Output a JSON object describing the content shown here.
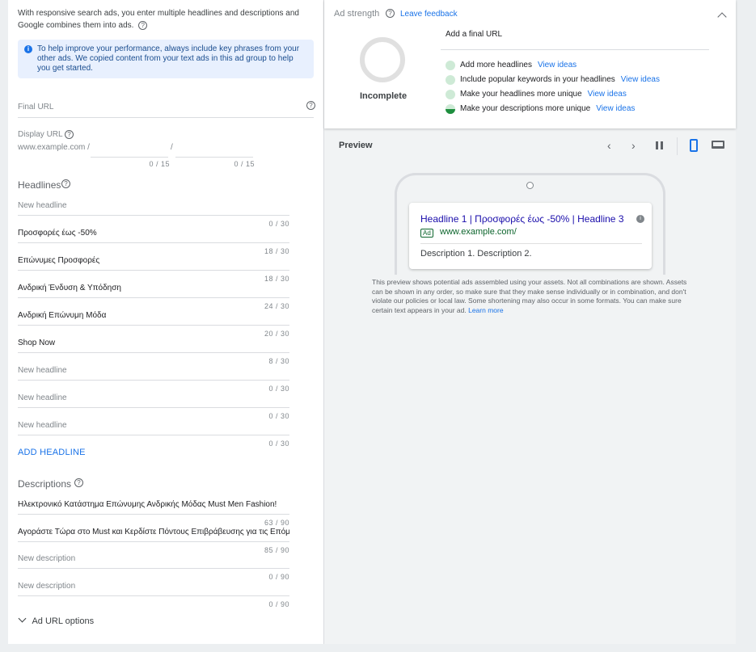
{
  "intro": {
    "text": "With responsive search ads, you enter multiple headlines and descriptions and Google combines them into ads.",
    "help_icon": "?"
  },
  "info_box": {
    "icon": "i",
    "text": "To help improve your performance, always include key phrases from your other ads. We copied content from your text ads in this ad group to help you get started."
  },
  "final_url": {
    "label": "Final URL",
    "value": "",
    "help_icon": "?"
  },
  "display_url": {
    "label": "Display URL",
    "help_icon": "?",
    "domain": "www.example.com /",
    "separator": "/",
    "path1_counter": "0 / 15",
    "path2_counter": "0 / 15"
  },
  "headlines": {
    "title": "Headlines",
    "help_icon": "?",
    "items": [
      {
        "text": "New headline",
        "placeholder": true,
        "counter": "0 / 30"
      },
      {
        "text": "Προσφορές έως -50%",
        "placeholder": false,
        "counter": "18 / 30"
      },
      {
        "text": "Επώνυμες Προσφορές",
        "placeholder": false,
        "counter": "18 / 30"
      },
      {
        "text": "Ανδρική Ένδυση & Υπόδηση",
        "placeholder": false,
        "counter": "24 / 30"
      },
      {
        "text": "Ανδρική Επώνυμη Μόδα",
        "placeholder": false,
        "counter": "20 / 30"
      },
      {
        "text": "Shop Now",
        "placeholder": false,
        "counter": "8 / 30"
      },
      {
        "text": "New headline",
        "placeholder": true,
        "counter": "0 / 30"
      },
      {
        "text": "New headline",
        "placeholder": true,
        "counter": "0 / 30"
      },
      {
        "text": "New headline",
        "placeholder": true,
        "counter": "0 / 30"
      }
    ],
    "add_label": "ADD HEADLINE"
  },
  "descriptions": {
    "title": "Descriptions",
    "help_icon": "?",
    "items": [
      {
        "text": "Ηλεκτρονικό Κατάστημα Επώνυμης Ανδρικής Μόδας Must Men Fashion!",
        "placeholder": false,
        "counter": "63 / 90"
      },
      {
        "text": "Αγοράστε Τώρα στο Must και Κερδίστε Πόντους Επιβράβευσης για τις Επόμ",
        "placeholder": false,
        "counter": "85 / 90"
      },
      {
        "text": "New description",
        "placeholder": true,
        "counter": "0 / 90"
      },
      {
        "text": "New description",
        "placeholder": true,
        "counter": "0 / 90"
      }
    ]
  },
  "ad_url_options": {
    "icon": "chevron-down-icon",
    "label": "Ad URL options"
  },
  "ad_strength": {
    "label": "Ad strength",
    "help_icon": "?",
    "feedback_link": "Leave feedback",
    "status": "Incomplete",
    "top_tip": "Add a final URL",
    "tips": [
      {
        "text": "Add more headlines",
        "link": "View ideas",
        "state": "light"
      },
      {
        "text": "Include popular keywords in your headlines",
        "link": "View ideas",
        "state": "light"
      },
      {
        "text": "Make your headlines more unique",
        "link": "View ideas",
        "state": "light"
      },
      {
        "text": "Make your descriptions more unique",
        "link": "View ideas",
        "state": "half"
      }
    ],
    "colors": {
      "ring": "#e0e0e0",
      "tip_light": "#ceead6",
      "tip_dark": "#1e8e3e"
    }
  },
  "preview": {
    "title": "Preview",
    "ad": {
      "headline": "Headline 1 | Προσφορές έως -50% | Headline 3",
      "badge": "Ad",
      "url": "www.example.com/",
      "description": "Description 1. Description 2."
    },
    "disclaimer": "This preview shows potential ads assembled using your assets. Not all combinations are shown. Assets can be shown in any order, so make sure that they make sense individually or in combination, and don't violate our policies or local law. Some shortening may also occur in some formats. You can make sure certain text appears in your ad.",
    "learn_more": "Learn more"
  },
  "colors": {
    "accent": "#1a73e8",
    "ad_url": "#0d652d",
    "ad_headline": "#1a0dab"
  }
}
